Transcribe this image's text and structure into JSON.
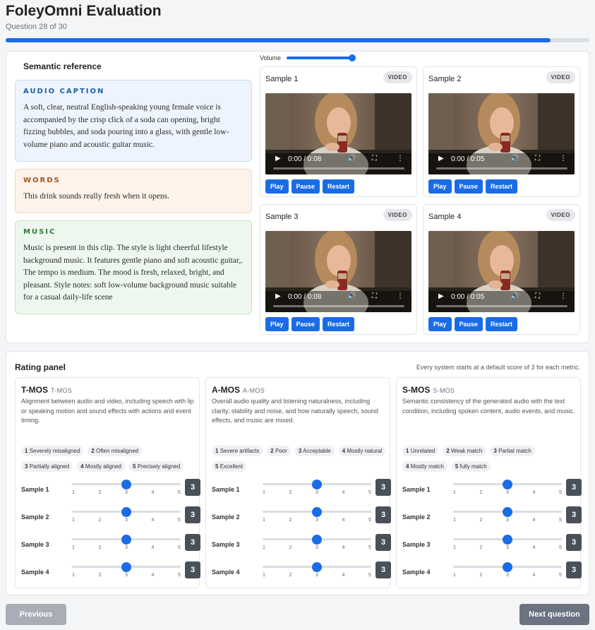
{
  "header": {
    "title": "FoleyOmni Evaluation",
    "subtitle": "Question 28 of 30",
    "progress_fraction": 0.933
  },
  "reference": {
    "title": "Semantic reference",
    "caption": {
      "label": "AUDIO CAPTION",
      "text": "A soft, clear, neutral English-speaking young female voice is accompanied by the crisp click of a soda can opening, bright fizzing bubbles, and soda pouring into a glass, with gentle low-volume piano and acoustic guitar music."
    },
    "words": {
      "label": "WORDS",
      "text": "This drink sounds really fresh when it opens."
    },
    "music": {
      "label": "MUSIC",
      "text": "Music is present in this clip. The style is light cheerful lifestyle background music. It features gentle piano and soft acoustic guitar,. The tempo is medium. The mood is fresh, relaxed, bright, and pleasant. Style notes: soft low-volume background music suitable for a casual daily-life scene"
    }
  },
  "volume": {
    "label": "Volume",
    "level": 1.0
  },
  "samples": [
    {
      "title": "Sample 1",
      "badge": "VIDEO",
      "time": "0:00 / 0:08"
    },
    {
      "title": "Sample 2",
      "badge": "VIDEO",
      "time": "0:00 / 0:05"
    },
    {
      "title": "Sample 3",
      "badge": "VIDEO",
      "time": "0:00 / 0:08"
    },
    {
      "title": "Sample 4",
      "badge": "VIDEO",
      "time": "0:00 / 0:05"
    }
  ],
  "player_buttons": {
    "play": "Play",
    "pause": "Pause",
    "restart": "Restart"
  },
  "rating": {
    "title": "Rating panel",
    "note": "Every system starts at a default score of 3 for each metric.",
    "row_labels": [
      "Sample 1",
      "Sample 2",
      "Sample 3",
      "Sample 4"
    ],
    "tick_labels": [
      "1",
      "2",
      "3",
      "4",
      "5"
    ],
    "metrics": [
      {
        "name": "T-MOS",
        "sub": "T-MOS",
        "desc": "Alignment between audio and video, including speech with lip or speaking motion and sound effects with actions and event timing.",
        "scale": [
          {
            "n": "1",
            "t": "Severely misaligned"
          },
          {
            "n": "2",
            "t": "Often misaligned"
          },
          {
            "n": "3",
            "t": "Partially aligned"
          },
          {
            "n": "4",
            "t": "Mostly aligned"
          },
          {
            "n": "5",
            "t": "Precisely aligned"
          }
        ],
        "scores": [
          "3",
          "3",
          "3",
          "3"
        ]
      },
      {
        "name": "A-MOS",
        "sub": "A-MOS",
        "desc": "Overall audio quality and listening naturalness, including clarity, stability and noise, and how naturally speech, sound effects, and music are mixed.",
        "scale": [
          {
            "n": "1",
            "t": "Severe artifacts"
          },
          {
            "n": "2",
            "t": "Poor"
          },
          {
            "n": "3",
            "t": "Acceptable"
          },
          {
            "n": "4",
            "t": "Mostly natural"
          },
          {
            "n": "5",
            "t": "Excellent"
          }
        ],
        "scores": [
          "3",
          "3",
          "3",
          "3"
        ]
      },
      {
        "name": "S-MOS",
        "sub": "S-MOS",
        "desc": "Semantic consistency of the generated audio with the text condition, including spoken content, audio events, and music.",
        "scale": [
          {
            "n": "1",
            "t": "Unrelated"
          },
          {
            "n": "2",
            "t": "Weak match"
          },
          {
            "n": "3",
            "t": "Partial match"
          },
          {
            "n": "4",
            "t": "Mostly match"
          },
          {
            "n": "5",
            "t": "fully match"
          }
        ],
        "scores": [
          "3",
          "3",
          "3",
          "3"
        ]
      }
    ]
  },
  "nav": {
    "previous": "Previous",
    "next": "Next question"
  }
}
